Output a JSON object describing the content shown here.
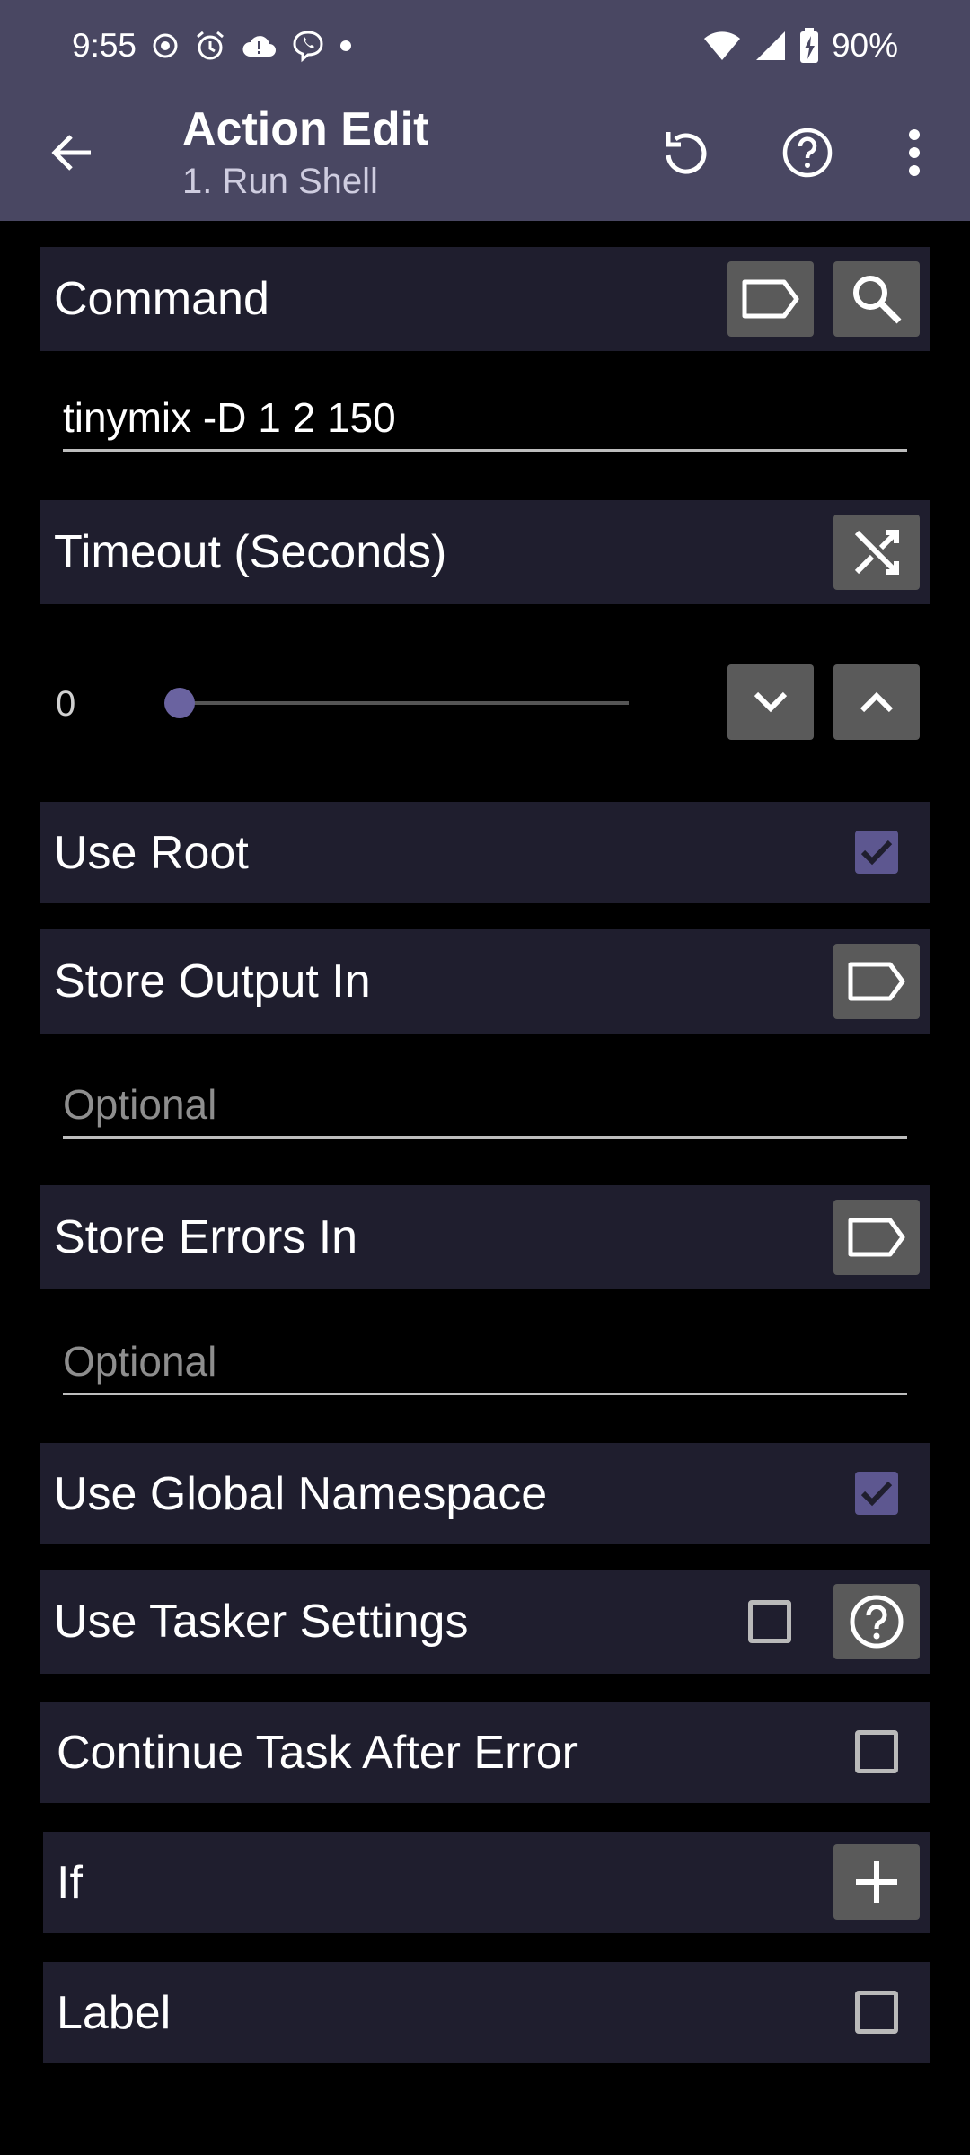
{
  "status_bar": {
    "time": "9:55",
    "battery": "90%"
  },
  "toolbar": {
    "title": "Action Edit",
    "subtitle": "1. Run Shell"
  },
  "command": {
    "label": "Command",
    "value": "tinymix -D 1 2 150"
  },
  "timeout": {
    "label": "Timeout (Seconds)",
    "value": "0",
    "slider_fraction": 0.0
  },
  "use_root": {
    "label": "Use Root",
    "checked": true
  },
  "store_output": {
    "label": "Store Output In",
    "placeholder": "Optional"
  },
  "store_errors": {
    "label": "Store Errors In",
    "placeholder": "Optional"
  },
  "use_global_namespace": {
    "label": "Use Global Namespace",
    "checked": true
  },
  "use_tasker_settings": {
    "label": "Use Tasker Settings",
    "checked": false
  },
  "continue_after_error": {
    "label": "Continue Task After Error",
    "checked": false
  },
  "if_condition": {
    "label": "If"
  },
  "label_row": {
    "label": "Label",
    "checked": false
  },
  "colors": {
    "toolbar_bg": "#494762",
    "row_bg": "#1f1e2e",
    "accent": "#5d5790",
    "button_bg": "#5a5a5a"
  }
}
